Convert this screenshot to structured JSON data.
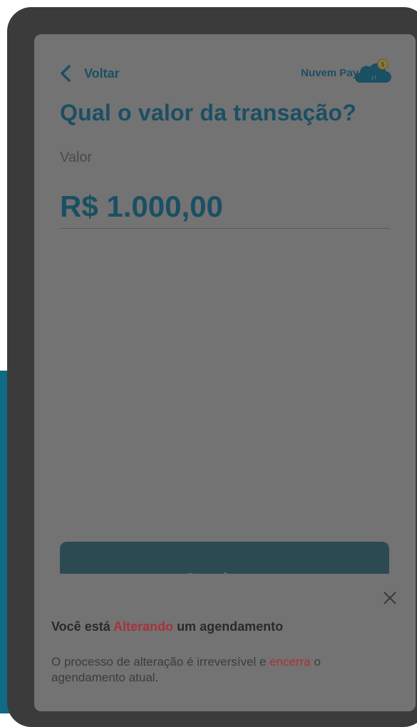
{
  "header": {
    "back_label": "Voltar",
    "brand_name": "Nuvem Pay"
  },
  "main": {
    "title": "Qual o valor da transação?",
    "amount_label": "Valor",
    "amount_value": "R$ 1.000,00",
    "continue_label": "Continuar"
  },
  "notice": {
    "title_prefix": "Você está ",
    "title_highlight": "Alterando",
    "title_suffix": " um agendamento",
    "body_prefix": "O processo de alteração é irreversível e ",
    "body_highlight": "encerra",
    "body_suffix": " o agendamento atual."
  },
  "colors": {
    "primary": "#1b4f63",
    "highlight": "#a8323a",
    "backdrop_accent": "#0f6a86"
  },
  "icons": {
    "back": "chevron-left-icon",
    "brand": "cloud-coin-logo",
    "close": "close-icon"
  }
}
